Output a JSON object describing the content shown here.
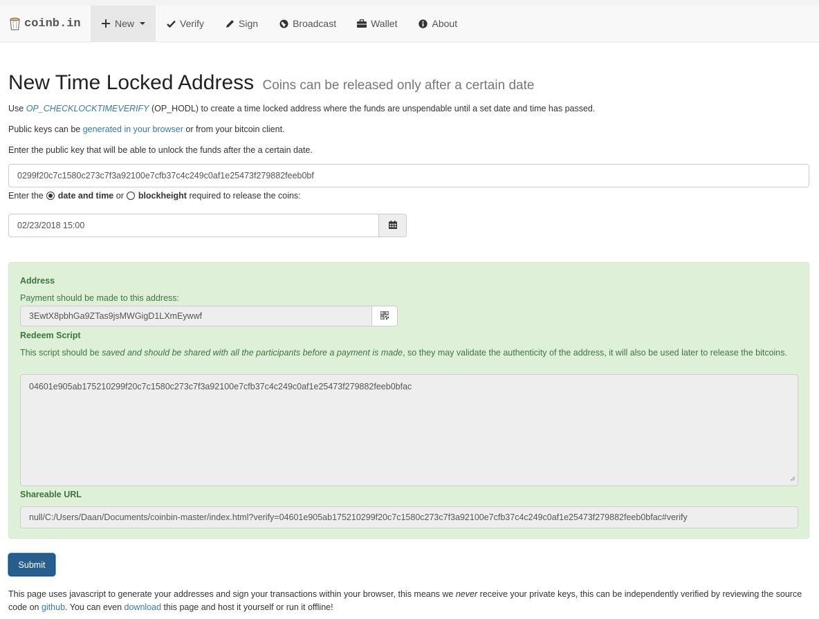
{
  "nav": {
    "brand": "coinb.in",
    "items": [
      {
        "label": "New",
        "icon": "plus-icon"
      },
      {
        "label": "Verify",
        "icon": "check-icon"
      },
      {
        "label": "Sign",
        "icon": "pencil-icon"
      },
      {
        "label": "Broadcast",
        "icon": "globe-icon"
      },
      {
        "label": "Wallet",
        "icon": "briefcase-icon"
      },
      {
        "label": "About",
        "icon": "info-icon"
      }
    ]
  },
  "page": {
    "title": "New Time Locked Address",
    "subtitle": "Coins can be released only after a certain date",
    "intro_prefix": "Use ",
    "intro_link": "OP_CHECKLOCKTIMEVERIFY",
    "intro_suffix": " (OP_HODL) to create a time locked address where the funds are unspendable until a set date and time has passed.",
    "pubkey_prefix": "Public keys can be ",
    "pubkey_link": "generated in your browser",
    "pubkey_suffix": " or from your bitcoin client.",
    "enter_pubkey_label": "Enter the public key that will be able to unlock the funds after the a certain date.",
    "pubkey_value": "0299f20c7c1580c273c7f3a92100e7cfb37c4c249c0af1e25473f279882feeb0bf",
    "release_prefix": "Enter the ",
    "option_date": "date and time",
    "release_or": " or ",
    "option_block": "blockheight",
    "release_suffix": " required to release the coins:",
    "date_value": "02/23/2018 15:00"
  },
  "result": {
    "address_label": "Address",
    "address_help": "Payment should be made to this address:",
    "address_value": "3EwtX8pbhGa9ZTas9jsMWGigD1LXmEywwf",
    "redeem_label": "Redeem Script",
    "redeem_help_prefix": "This script should be ",
    "redeem_help_em": "saved and should be shared with all the participants before a payment is made",
    "redeem_help_suffix": ", so they may validate the authenticity of the address, it will also be used later to release the bitcoins.",
    "redeem_value": "04601e905ab175210299f20c7c1580c273c7f3a92100e7cfb37c4c249c0af1e25473f279882feeb0bfac",
    "url_label": "Shareable URL",
    "url_value": "null/C:/Users/Daan/Documents/coinbin-master/index.html?verify=04601e905ab175210299f20c7c1580c273c7f3a92100e7cfb37c4c249c0af1e25473f279882feeb0bfac#verify"
  },
  "actions": {
    "submit": "Submit"
  },
  "footer": {
    "p1": "This page uses javascript to generate your addresses and sign your transactions within your browser, this means we ",
    "em": "never",
    "p2": " receive your private keys, this can be independently verified by reviewing the source code on ",
    "github": "github",
    "p3": ". You can even ",
    "download": "download",
    "p4": " this page and host it yourself or run it offline!"
  }
}
